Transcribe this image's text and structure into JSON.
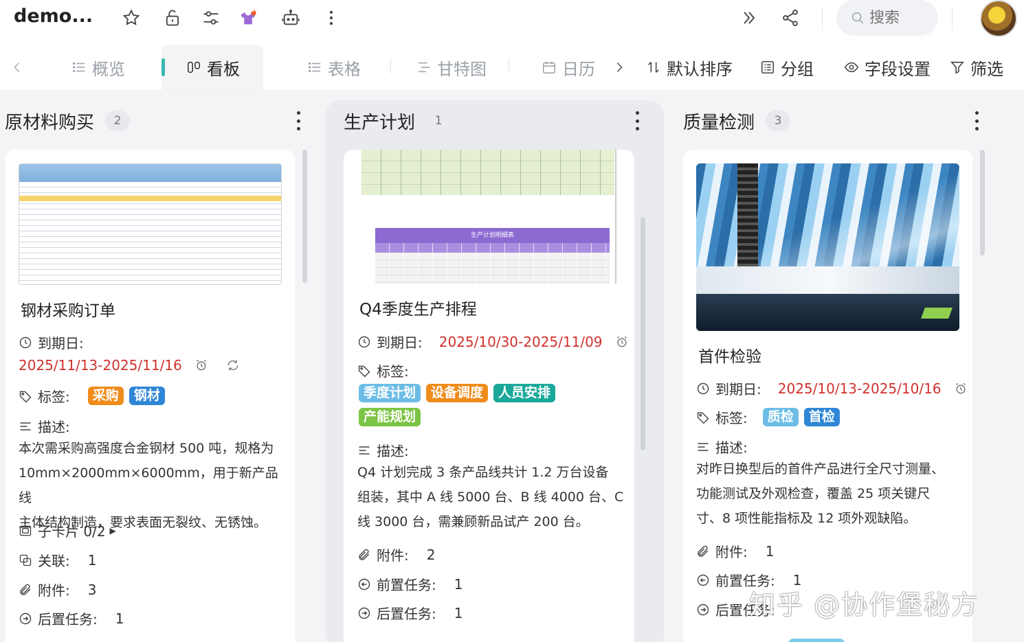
{
  "header": {
    "title": "demo...",
    "search_placeholder": "搜索"
  },
  "tabs": [
    {
      "label": "概览"
    },
    {
      "label": "看板"
    },
    {
      "label": "表格"
    },
    {
      "label": "甘特图"
    },
    {
      "label": "日历"
    }
  ],
  "toolbar": {
    "sort": "默认排序",
    "group": "分组",
    "fields": "字段设置",
    "filter": "筛选"
  },
  "columns": [
    {
      "title": "原材料购买",
      "count": "2",
      "card": {
        "title": "钢材采购订单",
        "due_label": "到期日:",
        "due": "2025/11/13-2025/11/16",
        "tags_label": "标签:",
        "tags": [
          "采购",
          "钢材"
        ],
        "desc_label": "描述:",
        "desc": [
          "本次需采购高强度合金钢材 500 吨，规格为",
          "10mm×2000mm×6000mm，用于新产品线",
          "主体结构制造，要求表面无裂纹、无锈蚀。"
        ],
        "subcards": "子卡片 0/2",
        "relation_label": "关联:",
        "relation": "1",
        "attach_label": "附件:",
        "attach": "3",
        "next_label": "后置任务:",
        "next": "1"
      }
    },
    {
      "title": "生产计划",
      "count": "1",
      "card": {
        "title": "Q4季度生产排程",
        "due_label": "到期日:",
        "due": "2025/10/30-2025/11/09",
        "tags_label": "标签:",
        "tags": [
          "季度计划",
          "设备调度",
          "人员安排",
          "产能规划"
        ],
        "desc_label": "描述:",
        "desc": [
          "Q4 计划完成 3 条产品线共计 1.2 万台设备",
          "组装，其中 A 线 5000 台、B 线 4000 台、C",
          "线 3000 台，需兼顾新品试产 200 台。"
        ],
        "attach_label": "附件:",
        "attach": "2",
        "prev_label": "前置任务:",
        "prev": "1",
        "next_label": "后置任务:",
        "next": "1",
        "sheet_title": "生产计划明细表"
      }
    },
    {
      "title": "质量检测",
      "count": "3",
      "card": {
        "title": "首件检验",
        "due_label": "到期日:",
        "due": "2025/10/13-2025/10/16",
        "tags_label": "标签:",
        "tags": [
          "质检",
          "首检"
        ],
        "desc_label": "描述:",
        "desc": [
          "对昨日换型后的首件产品进行全尺寸测量、",
          "功能测试及外观检查，覆盖 25 项关键尺",
          "寸、8 项性能指标及 12 项外观缺陷。"
        ],
        "attach_label": "附件:",
        "attach": "1",
        "prev_label": "前置任务:",
        "prev": "1",
        "next_label": "后置任务:"
      }
    }
  ],
  "watermark": "知乎 @协作堡秘方",
  "colors": {
    "accent": "#3ab8b0",
    "date_red": "#d0312d",
    "tag_orange": "#f08c1c",
    "tag_blue": "#2f86d6",
    "tag_lightblue": "#6cbde6",
    "tag_teal": "#1ba89b",
    "tag_green": "#7cc444"
  }
}
